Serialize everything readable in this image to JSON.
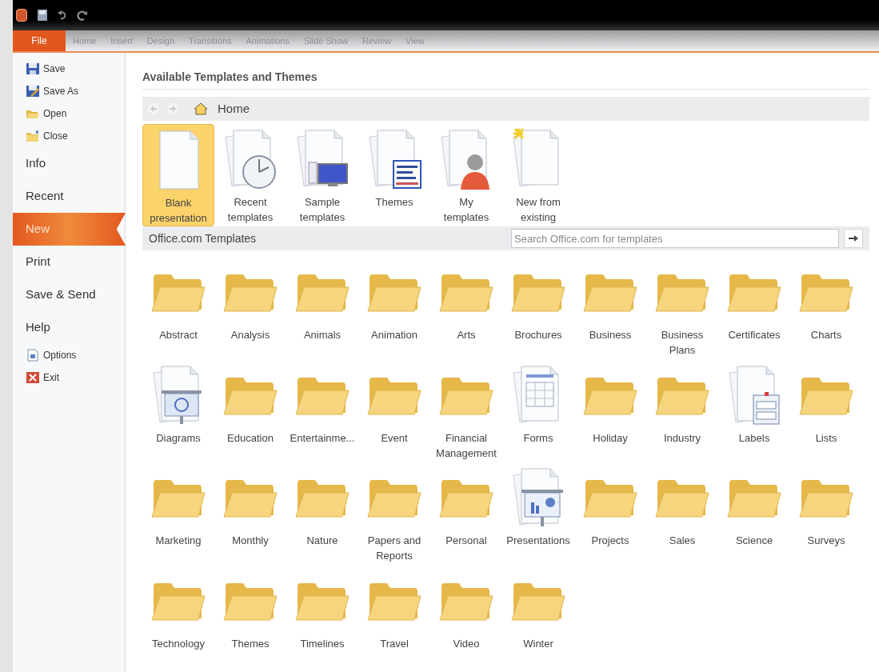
{
  "quick_access": [
    {
      "kind": "save"
    },
    {
      "kind": "undo"
    },
    {
      "kind": "redo"
    }
  ],
  "ribbon_tabs": [
    {
      "label": "File",
      "selected": true
    },
    {
      "label": "Home",
      "selected": false
    },
    {
      "label": "Insert",
      "selected": false
    },
    {
      "label": "Design",
      "selected": false
    },
    {
      "label": "Transitions",
      "selected": false
    },
    {
      "label": "Animations",
      "selected": false
    },
    {
      "label": "Slide Show",
      "selected": false
    },
    {
      "label": "Review",
      "selected": false
    },
    {
      "label": "View",
      "selected": false
    }
  ],
  "sidebar": {
    "items": [
      {
        "label": "Save",
        "kind": "command",
        "selected": false
      },
      {
        "label": "Save As",
        "kind": "command",
        "selected": false
      },
      {
        "label": "Open",
        "kind": "command",
        "selected": false
      },
      {
        "label": "Close",
        "kind": "command",
        "selected": false
      },
      {
        "label": "Info",
        "kind": "page",
        "selected": false
      },
      {
        "label": "Recent",
        "kind": "page",
        "selected": false
      },
      {
        "label": "New",
        "kind": "page",
        "selected": true
      },
      {
        "label": "Print",
        "kind": "page",
        "selected": false
      },
      {
        "label": "Save & Send",
        "kind": "page",
        "selected": false
      },
      {
        "label": "Help",
        "kind": "page",
        "selected": false
      },
      {
        "label": "Options",
        "kind": "command",
        "selected": false
      },
      {
        "label": "Exit",
        "kind": "command",
        "selected": false
      }
    ]
  },
  "heading": "Available Templates and Themes",
  "breadcrumb": "Home",
  "start_items": [
    {
      "label": "Blank\npresentation",
      "kind": "blank",
      "selected": true
    },
    {
      "label": "Recent\ntemplates",
      "kind": "recent",
      "selected": false
    },
    {
      "label": "Sample\ntemplates",
      "kind": "sample",
      "selected": false
    },
    {
      "label": "Themes",
      "kind": "themes",
      "selected": false
    },
    {
      "label": "My\ntemplates",
      "kind": "my",
      "selected": false
    },
    {
      "label": "New from\nexisting",
      "kind": "existing",
      "selected": false
    }
  ],
  "office_section": {
    "title": "Office.com Templates",
    "search": {
      "placeholder": "Search Office.com for templates"
    }
  },
  "categories": [
    {
      "label": "Abstract",
      "kind": "folder"
    },
    {
      "label": "Analysis",
      "kind": "folder"
    },
    {
      "label": "Animals",
      "kind": "folder"
    },
    {
      "label": "Animation",
      "kind": "folder"
    },
    {
      "label": "Arts",
      "kind": "folder"
    },
    {
      "label": "Brochures",
      "kind": "folder"
    },
    {
      "label": "Business",
      "kind": "folder"
    },
    {
      "label": "Business\nPlans",
      "kind": "folder"
    },
    {
      "label": "Certificates",
      "kind": "folder"
    },
    {
      "label": "Charts",
      "kind": "folder"
    },
    {
      "label": "Diagrams",
      "kind": "diagram"
    },
    {
      "label": "Education",
      "kind": "folder"
    },
    {
      "label": "Entertainme...",
      "kind": "folder"
    },
    {
      "label": "Event",
      "kind": "folder"
    },
    {
      "label": "Financial\nManagement",
      "kind": "folder"
    },
    {
      "label": "Forms",
      "kind": "form"
    },
    {
      "label": "Holiday",
      "kind": "folder"
    },
    {
      "label": "Industry",
      "kind": "folder"
    },
    {
      "label": "Labels",
      "kind": "labels"
    },
    {
      "label": "Lists",
      "kind": "folder"
    },
    {
      "label": "Marketing",
      "kind": "folder"
    },
    {
      "label": "Monthly",
      "kind": "folder"
    },
    {
      "label": "Nature",
      "kind": "folder"
    },
    {
      "label": "Papers and\nReports",
      "kind": "folder"
    },
    {
      "label": "Personal",
      "kind": "folder"
    },
    {
      "label": "Presentations",
      "kind": "presentation"
    },
    {
      "label": "Projects",
      "kind": "folder"
    },
    {
      "label": "Sales",
      "kind": "folder"
    },
    {
      "label": "Science",
      "kind": "folder"
    },
    {
      "label": "Surveys",
      "kind": "folder"
    },
    {
      "label": "Technology",
      "kind": "folder"
    },
    {
      "label": "Themes",
      "kind": "folder"
    },
    {
      "label": "Timelines",
      "kind": "folder"
    },
    {
      "label": "Travel",
      "kind": "folder"
    },
    {
      "label": "Video",
      "kind": "folder"
    },
    {
      "label": "Winter",
      "kind": "folder"
    }
  ]
}
